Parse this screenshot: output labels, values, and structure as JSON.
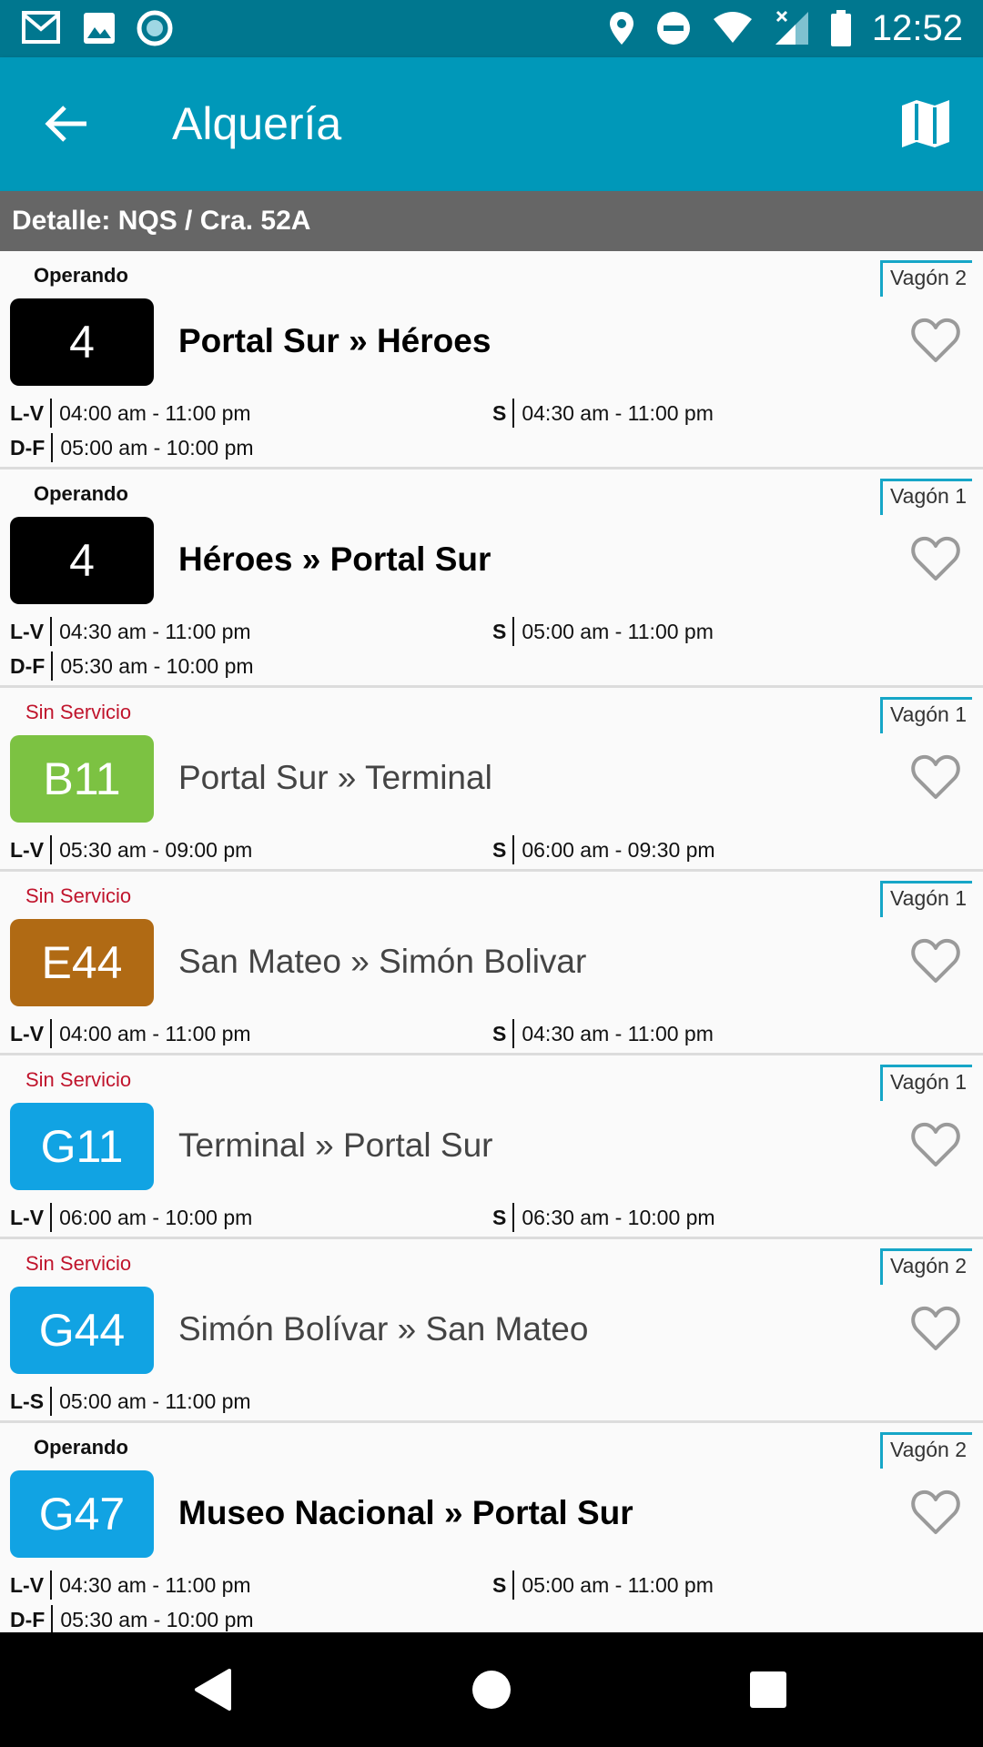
{
  "status_bar": {
    "time": "12:52",
    "left_icons": [
      "gmail-icon",
      "image-icon",
      "record-icon"
    ],
    "right_icons": [
      "location-icon",
      "do-not-disturb-icon",
      "wifi-icon",
      "signal-icon",
      "battery-icon"
    ]
  },
  "app_bar": {
    "title": "Alquería",
    "back_icon": "arrow-back-icon",
    "map_icon": "map-icon",
    "color": "#0098b9"
  },
  "subheader": {
    "text": "Detalle: NQS / Cra. 52A"
  },
  "routes": [
    {
      "status": "Operando",
      "operating": true,
      "vagon": "Vagón 2",
      "code": "4",
      "color": "#000000",
      "name": "Portal Sur » Héroes",
      "hours": [
        [
          {
            "label": "L-V",
            "time": "04:00 am - 11:00 pm"
          },
          {
            "label": "S",
            "time": "04:30 am - 11:00 pm"
          }
        ],
        [
          {
            "label": "D-F",
            "time": "05:00 am - 10:00 pm"
          }
        ]
      ]
    },
    {
      "status": "Operando",
      "operating": true,
      "vagon": "Vagón 1",
      "code": "4",
      "color": "#000000",
      "name": "Héroes » Portal Sur",
      "hours": [
        [
          {
            "label": "L-V",
            "time": "04:30 am - 11:00 pm"
          },
          {
            "label": "S",
            "time": "05:00 am - 11:00 pm"
          }
        ],
        [
          {
            "label": "D-F",
            "time": "05:30 am - 10:00 pm"
          }
        ]
      ]
    },
    {
      "status": "Sin Servicio",
      "operating": false,
      "vagon": "Vagón 1",
      "code": "B11",
      "color": "#7cc242",
      "name": "Portal Sur » Terminal",
      "hours": [
        [
          {
            "label": "L-V",
            "time": "05:30 am - 09:00 pm"
          },
          {
            "label": "S",
            "time": "06:00 am - 09:30 pm"
          }
        ]
      ]
    },
    {
      "status": "Sin Servicio",
      "operating": false,
      "vagon": "Vagón 1",
      "code": "E44",
      "color": "#b06a14",
      "name": "San Mateo » Simón Bolivar",
      "hours": [
        [
          {
            "label": "L-V",
            "time": "04:00 am - 11:00 pm"
          },
          {
            "label": "S",
            "time": "04:30 am - 11:00 pm"
          }
        ]
      ]
    },
    {
      "status": "Sin Servicio",
      "operating": false,
      "vagon": "Vagón 1",
      "code": "G11",
      "color": "#11a3e3",
      "name": "Terminal » Portal Sur",
      "hours": [
        [
          {
            "label": "L-V",
            "time": "06:00 am - 10:00 pm"
          },
          {
            "label": "S",
            "time": "06:30 am - 10:00 pm"
          }
        ]
      ]
    },
    {
      "status": "Sin Servicio",
      "operating": false,
      "vagon": "Vagón 2",
      "code": "G44",
      "color": "#11a3e3",
      "name": "Simón Bolívar » San Mateo",
      "hours": [
        [
          {
            "label": "L-S",
            "time": "05:00 am - 11:00 pm"
          }
        ]
      ]
    },
    {
      "status": "Operando",
      "operating": true,
      "vagon": "Vagón 2",
      "code": "G47",
      "color": "#11a3e3",
      "name": "Museo Nacional » Portal Sur",
      "hours": [
        [
          {
            "label": "L-V",
            "time": "04:30 am - 11:00 pm"
          },
          {
            "label": "S",
            "time": "05:00 am - 11:00 pm"
          }
        ],
        [
          {
            "label": "D-F",
            "time": "05:30 am - 10:00 pm"
          }
        ]
      ]
    }
  ],
  "nav_bar": {
    "icons": [
      "back-triangle-icon",
      "home-circle-icon",
      "recents-square-icon"
    ]
  }
}
